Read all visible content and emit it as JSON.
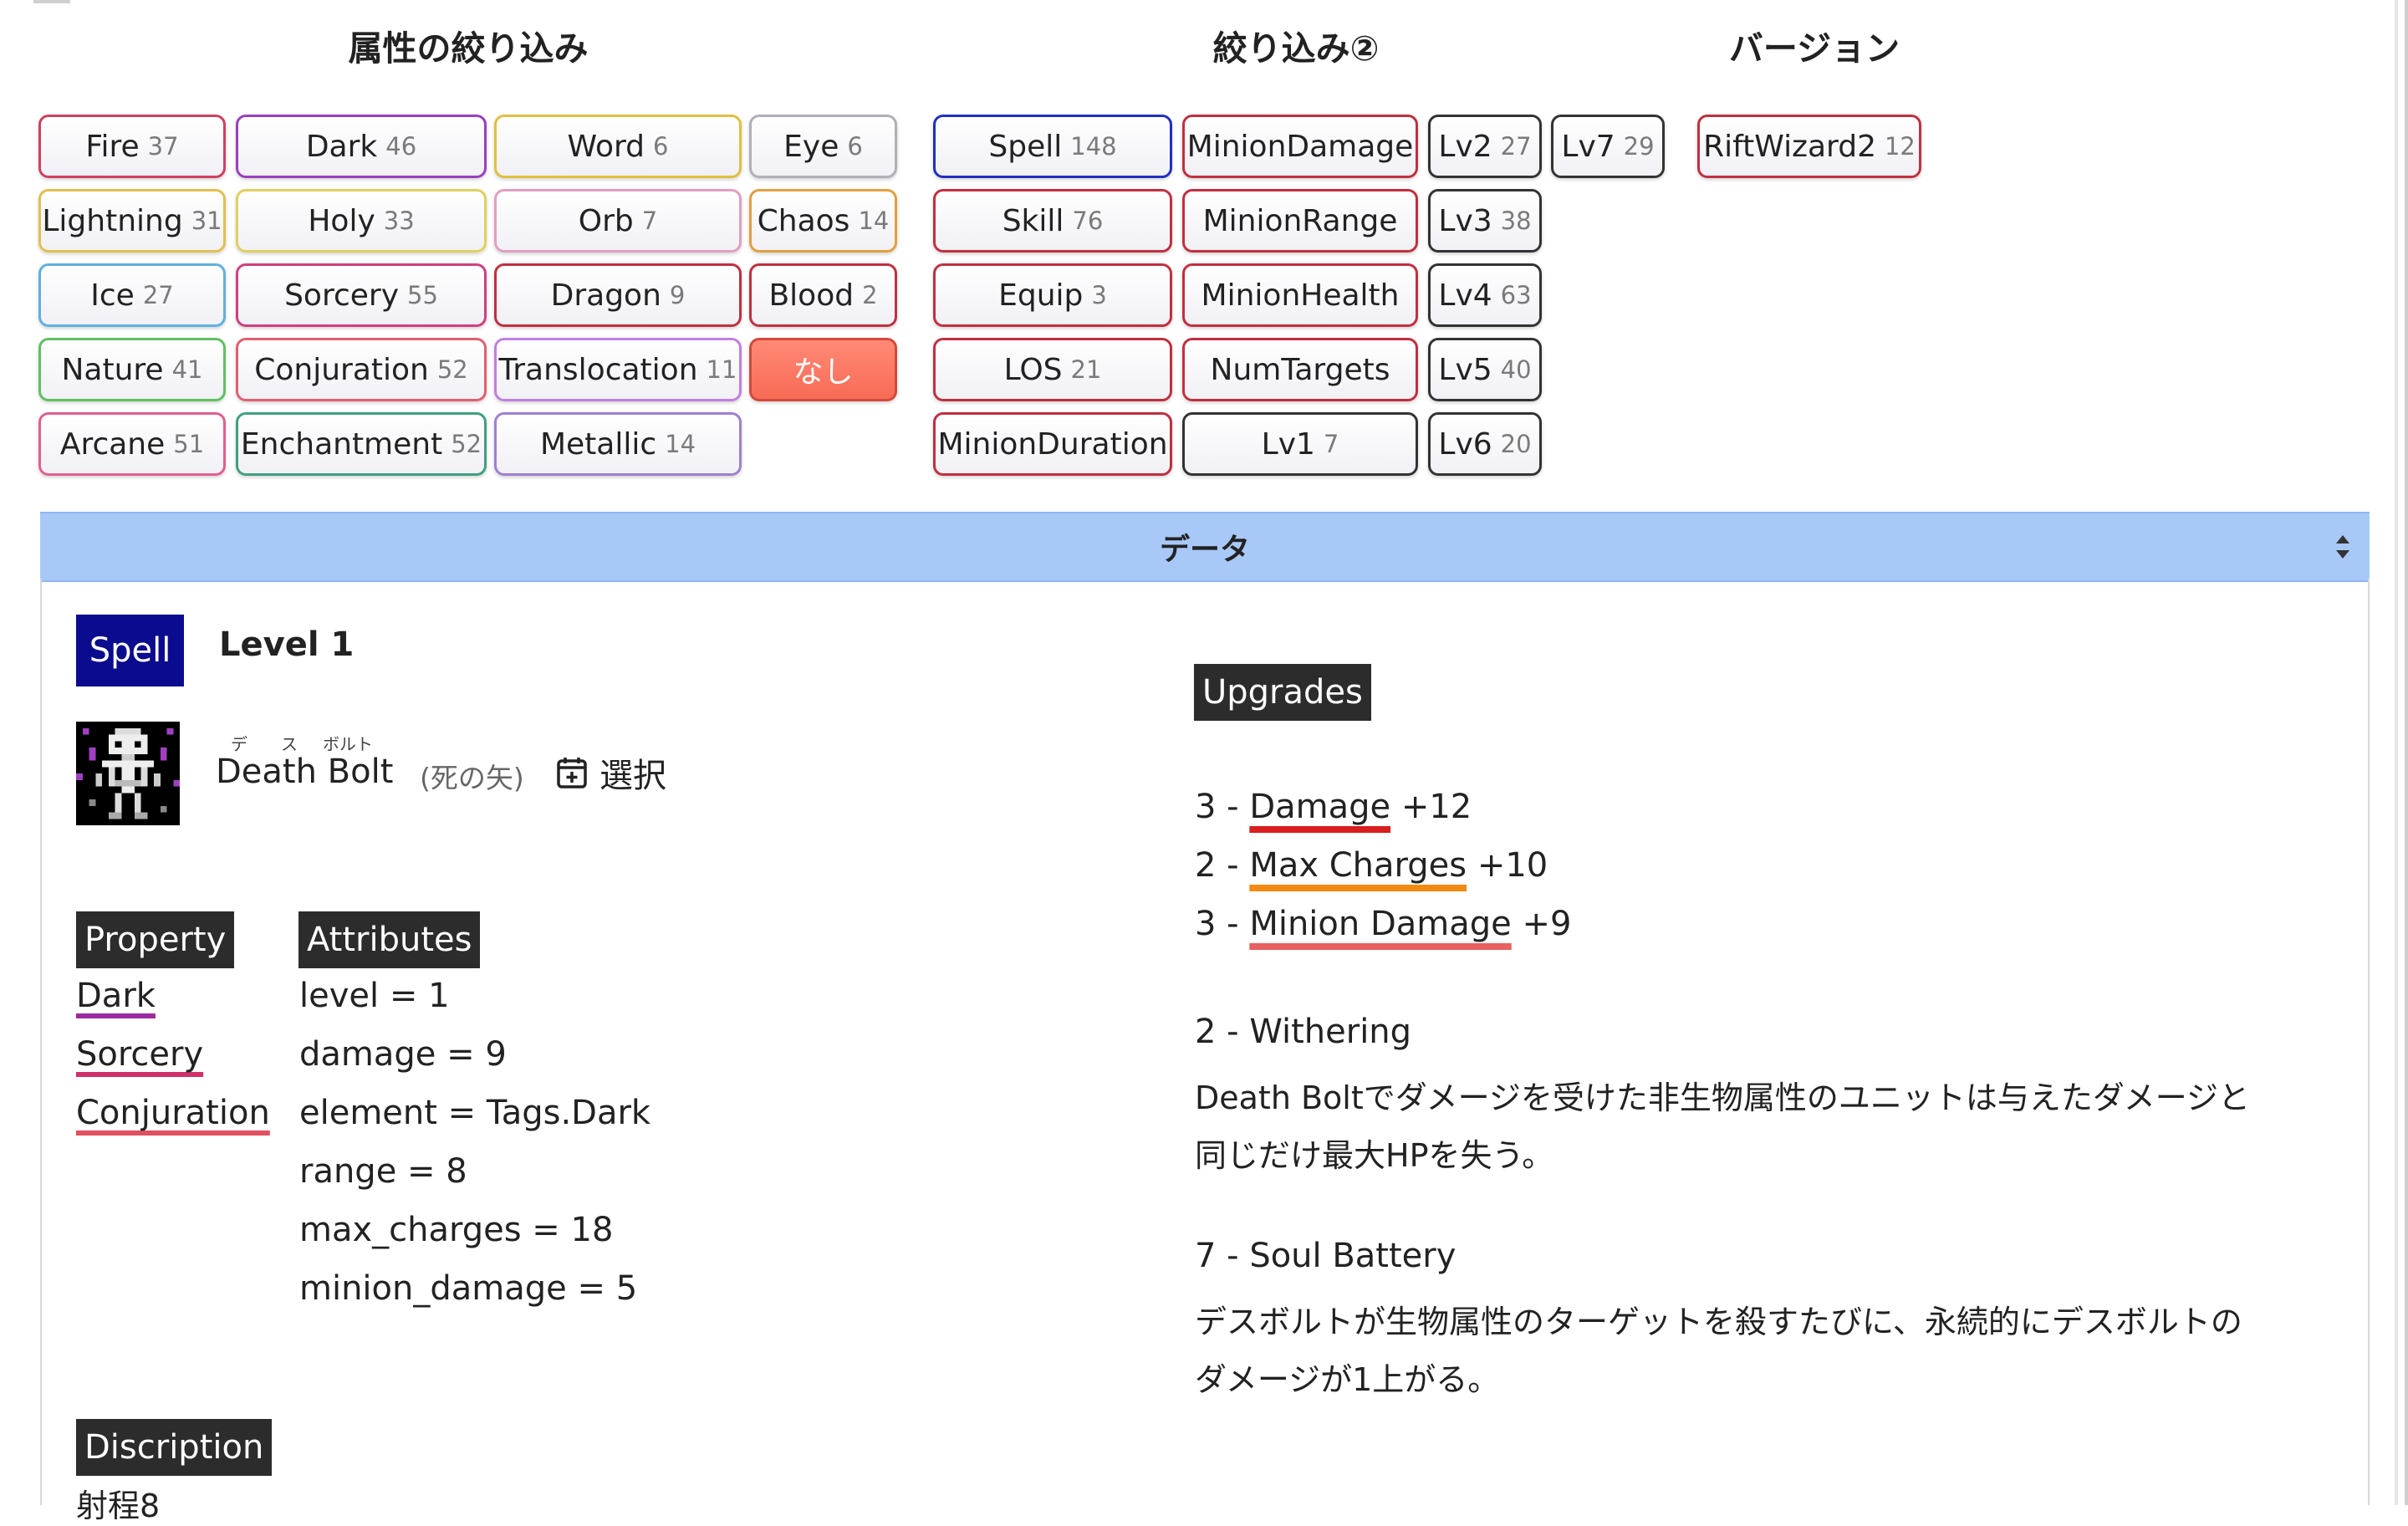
{
  "sections": {
    "attributes_title": "属性の絞り込み",
    "filter2_title": "絞り込み②",
    "version_title": "バージョン"
  },
  "attribute_chips": [
    {
      "label": "Fire",
      "count": "37",
      "color": "#d04060"
    },
    {
      "label": "Dark",
      "count": "46",
      "color": "#9a40c0"
    },
    {
      "label": "Word",
      "count": "6",
      "color": "#e0c040"
    },
    {
      "label": "Eye",
      "count": "6",
      "color": "#b0b0b8"
    },
    {
      "label": "Lightning",
      "count": "31",
      "color": "#e0c050"
    },
    {
      "label": "Holy",
      "count": "33",
      "color": "#e0d060"
    },
    {
      "label": "Orb",
      "count": "7",
      "color": "#e0a0c0"
    },
    {
      "label": "Chaos",
      "count": "14",
      "color": "#e0a040"
    },
    {
      "label": "Ice",
      "count": "27",
      "color": "#60b0e0"
    },
    {
      "label": "Sorcery",
      "count": "55",
      "color": "#d04080"
    },
    {
      "label": "Dragon",
      "count": "9",
      "color": "#c03040"
    },
    {
      "label": "Blood",
      "count": "2",
      "color": "#c03040"
    },
    {
      "label": "Nature",
      "count": "41",
      "color": "#60c060"
    },
    {
      "label": "Conjuration",
      "count": "52",
      "color": "#e06070"
    },
    {
      "label": "Translocation",
      "count": "11",
      "color": "#c080e0"
    },
    {
      "label": "なし",
      "count": "",
      "color": "#d24a3c"
    },
    {
      "label": "Arcane",
      "count": "51",
      "color": "#e06090"
    },
    {
      "label": "Enchantment",
      "count": "52",
      "color": "#40a080"
    },
    {
      "label": "Metallic",
      "count": "14",
      "color": "#a080d0"
    }
  ],
  "filter2_chips": [
    {
      "label": "Spell",
      "count": "148",
      "color": "#2030c0"
    },
    {
      "label": "MinionDamage",
      "count": "",
      "color": "#c03040"
    },
    {
      "label": "Lv2",
      "count": "27",
      "color": "#333333"
    },
    {
      "label": "Lv7",
      "count": "29",
      "color": "#333333"
    },
    {
      "label": "Skill",
      "count": "76",
      "color": "#c03040"
    },
    {
      "label": "MinionRange",
      "count": "",
      "color": "#c03040"
    },
    {
      "label": "Lv3",
      "count": "38",
      "color": "#333333"
    },
    {
      "label": "Equip",
      "count": "3",
      "color": "#c03040"
    },
    {
      "label": "MinionHealth",
      "count": "",
      "color": "#c03040"
    },
    {
      "label": "Lv4",
      "count": "63",
      "color": "#333333"
    },
    {
      "label": "LOS",
      "count": "21",
      "color": "#c03040"
    },
    {
      "label": "NumTargets",
      "count": "",
      "color": "#c03040"
    },
    {
      "label": "Lv5",
      "count": "40",
      "color": "#333333"
    },
    {
      "label": "MinionDuration",
      "count": "",
      "color": "#c03040"
    },
    {
      "label": "Lv1",
      "count": "7",
      "color": "#333333"
    },
    {
      "label": "Lv6",
      "count": "20",
      "color": "#333333"
    }
  ],
  "version_chips": [
    {
      "label": "RiftWizard2",
      "count": "12",
      "color": "#c03040"
    }
  ],
  "data_header": "データ",
  "detail": {
    "type_badge": "Spell",
    "level": "Level 1",
    "ruby": [
      "デ",
      "ス",
      "ボルト"
    ],
    "name": "Death Bolt",
    "name_jp": "(死の矢)",
    "select_label": "選択",
    "property_header": "Property",
    "properties": [
      {
        "label": "Dark",
        "color": "#9a2aa0"
      },
      {
        "label": "Sorcery",
        "color": "#d0306a"
      },
      {
        "label": "Conjuration",
        "color": "#e05060"
      }
    ],
    "attributes_header": "Attributes",
    "attributes": [
      "level = 1",
      "damage = 9",
      "element = Tags.Dark",
      "range = 8",
      "max_charges = 18",
      "minion_damage = 5"
    ],
    "description_header": "Discription",
    "description_text": "射程8",
    "upgrades_header": "Upgrades",
    "upgrades": [
      {
        "prefix": "3 - ",
        "stat": "Damage",
        "suffix": " +12",
        "color": "#d81e1e"
      },
      {
        "prefix": "2 - ",
        "stat": "Max Charges",
        "suffix": " +10",
        "color": "#f08a10"
      },
      {
        "prefix": "3 - ",
        "stat": "Minion Damage",
        "suffix": " +9",
        "color": "#e86060"
      }
    ],
    "upgrade_texts": [
      {
        "title": "2 - Withering",
        "lines": [
          "Death Boltでダメージを受けた非生物属性のユニットは与えたダメージと",
          "同じだけ最大HPを失う。"
        ]
      },
      {
        "title": "7 - Soul Battery",
        "lines": [
          "デスボルトが生物属性のターゲットを殺すたびに、永続的にデスボルトの",
          "ダメージが1上がる。"
        ]
      }
    ]
  }
}
